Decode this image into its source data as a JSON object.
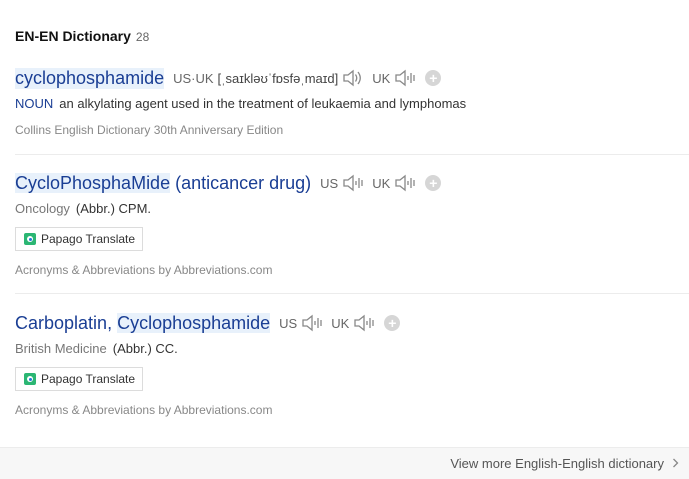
{
  "header": {
    "title": "EN-EN Dictionary",
    "count": "28"
  },
  "entries": [
    {
      "word": "cyclophosphamide",
      "pron_label": "US·UK",
      "ipa": "[ˌsaɪkləʊˈfɒsfəˌmaɪd]",
      "uk_label": "UK",
      "pos": "NOUN",
      "definition": "an alkylating agent used in the treatment of leukaemia and lymphomas",
      "source": "Collins English Dictionary 30th Anniversary Edition"
    },
    {
      "word": "CycloPhosphaMide",
      "word_rest": " (anticancer drug)",
      "us_label": "US",
      "uk_label": "UK",
      "category": "Oncology",
      "abbr": "(Abbr.) CPM.",
      "papago": "Papago Translate",
      "source": "Acronyms & Abbreviations by Abbreviations.com"
    },
    {
      "word_a": "Carboplatin",
      "word_sep": ", ",
      "word_b": "Cyclophosphamide",
      "us_label": "US",
      "uk_label": "UK",
      "category": "British Medicine",
      "abbr": "(Abbr.) CC.",
      "papago": "Papago Translate",
      "source": "Acronyms & Abbreviations by Abbreviations.com"
    }
  ],
  "footer": {
    "more": "View more English-English dictionary"
  },
  "icons": {
    "speaker": "speaker-icon",
    "add": "plus-circle-icon",
    "papago": "papago-logo-icon",
    "chevron": "chevron-right-icon"
  },
  "colors": {
    "link": "#1a3e94",
    "highlight": "#e8f1fb",
    "papago": "#2bb673"
  }
}
